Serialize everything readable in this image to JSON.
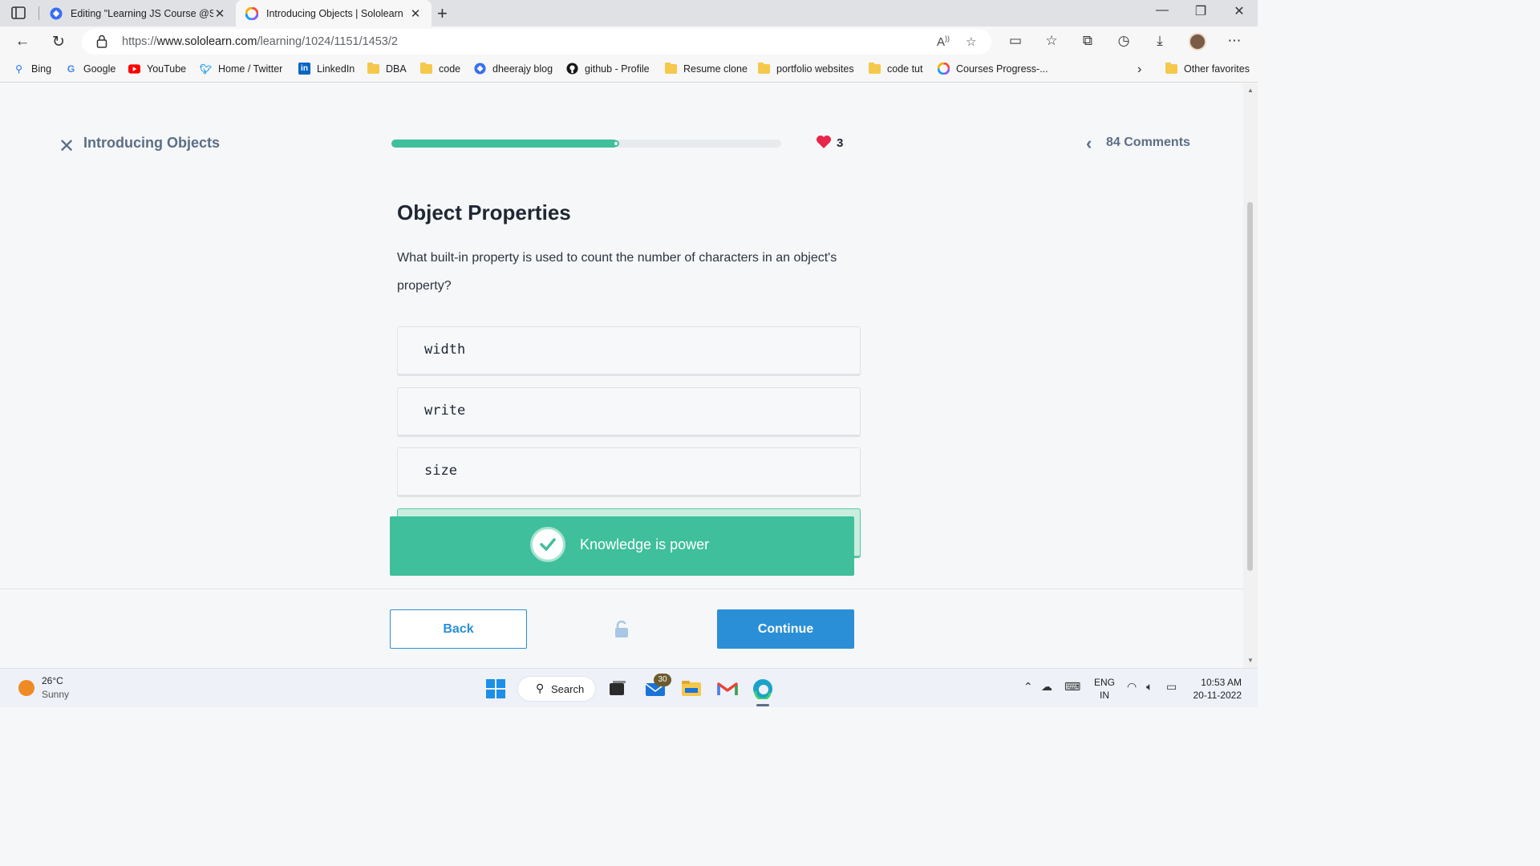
{
  "browser": {
    "tabs": [
      {
        "title": "Editing \"Learning JS Course @Sc",
        "active": false
      },
      {
        "title": "Introducing Objects | Sololearn",
        "active": true
      }
    ],
    "url_prefix": "https://",
    "url_domain": "www.sololearn.com",
    "url_path": "/learning/1024/1151/1453/2",
    "favorites": [
      {
        "label": "Bing",
        "icon": "bing-icon"
      },
      {
        "label": "Google",
        "icon": "google-icon"
      },
      {
        "label": "YouTube",
        "icon": "youtube-icon"
      },
      {
        "label": "Home / Twitter",
        "icon": "twitter-icon"
      },
      {
        "label": "LinkedIn",
        "icon": "linkedin-icon"
      },
      {
        "label": "DBA",
        "icon": "folder-icon"
      },
      {
        "label": "code",
        "icon": "folder-icon"
      },
      {
        "label": "dheerajy blog",
        "icon": "blog-icon"
      },
      {
        "label": "github - Profile",
        "icon": "github-icon"
      },
      {
        "label": "Resume clone",
        "icon": "folder-icon"
      },
      {
        "label": "portfolio websites",
        "icon": "folder-icon"
      },
      {
        "label": "code tut",
        "icon": "folder-icon"
      },
      {
        "label": "Courses Progress-...",
        "icon": "sololearn-icon"
      }
    ],
    "other_favorites": "Other favorites"
  },
  "lesson": {
    "title": "Introducing Objects",
    "progress_fraction": 0.58,
    "lives": "3",
    "comments": "84 Comments"
  },
  "question": {
    "title": "Object Properties",
    "text": "What built-in property is used to count the number of characters in an object's property?",
    "options": [
      "width",
      "write",
      "size",
      ""
    ]
  },
  "toast": {
    "message": "Knowledge is power"
  },
  "footer": {
    "back_label": "Back",
    "continue_label": "Continue"
  },
  "taskbar": {
    "temperature": "26°C",
    "condition": "Sunny",
    "search_label": "Search",
    "mail_badge": "30",
    "lang_line1": "ENG",
    "lang_line2": "IN",
    "time": "10:53 AM",
    "date": "20-11-2022"
  },
  "colors": {
    "accent_green": "#3fbf9b",
    "accent_blue": "#2a8fd6",
    "heart_red": "#e8254a"
  }
}
